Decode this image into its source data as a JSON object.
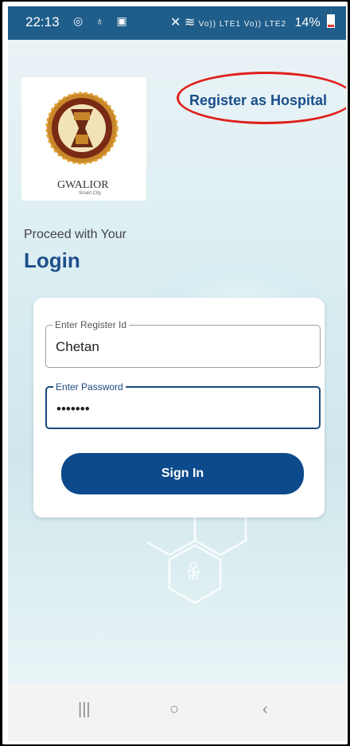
{
  "status_bar": {
    "time": "22:13",
    "left_icons": "◎ ♁ ▣",
    "network": "Vo)) LTE1 Vo)) LTE2",
    "battery": "14%"
  },
  "header": {
    "logo_text": "GWALIOR",
    "logo_subtext": "Smart City",
    "register_link": "Register as Hospital"
  },
  "intro": {
    "subtitle": "Proceed with Your",
    "title": "Login"
  },
  "form": {
    "register_id": {
      "label": "Enter Register Id",
      "value": "Chetan"
    },
    "password": {
      "label": "Enter Password",
      "value": "•••••••"
    },
    "submit_label": "Sign In"
  },
  "navbar": {
    "recent": "|||",
    "home": "○",
    "back": "‹"
  },
  "colors": {
    "status_bar": "#1f5d8a",
    "primary": "#0d4a8c",
    "title": "#1c4f8a",
    "highlight": "#e0201b"
  }
}
